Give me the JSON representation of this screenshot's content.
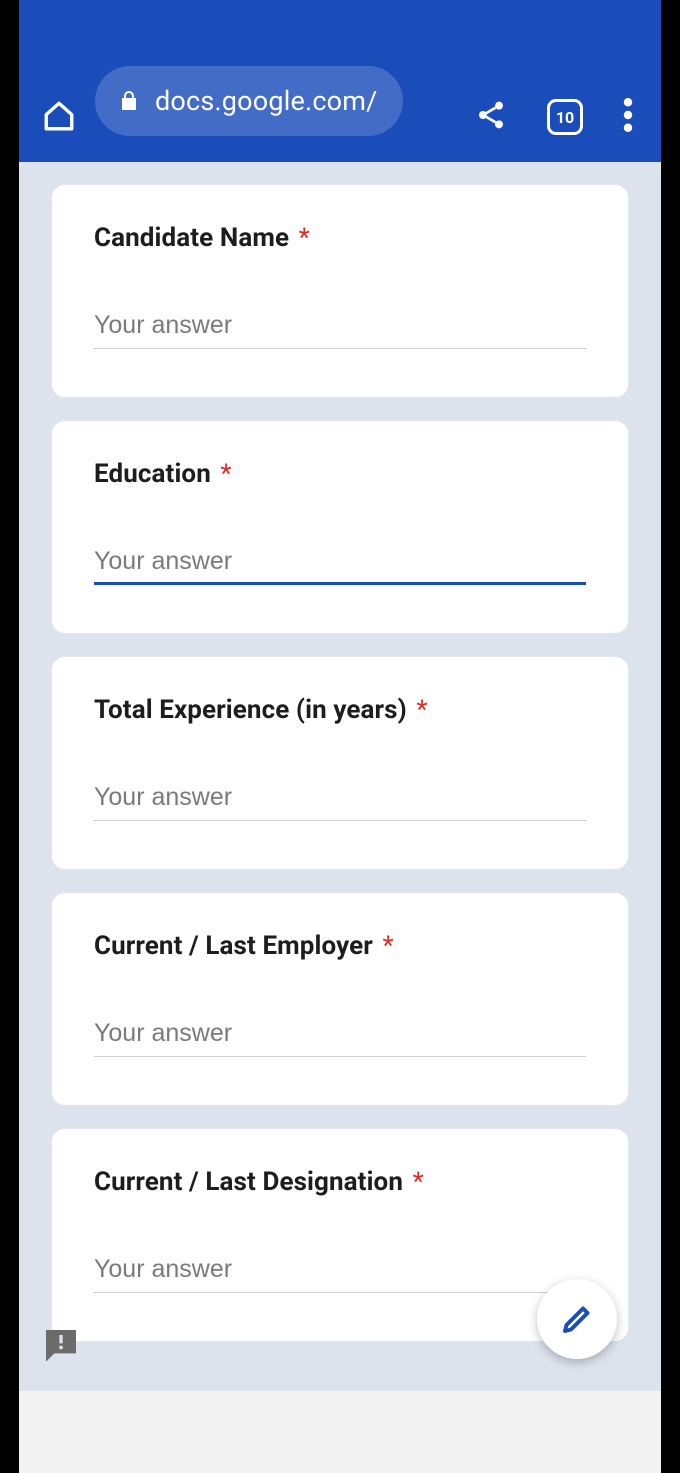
{
  "browser": {
    "url": "docs.google.com/",
    "tab_count": "10"
  },
  "form": {
    "placeholder": "Your answer",
    "focused_index": 1,
    "questions": [
      {
        "label": "Candidate Name",
        "required": true,
        "value": ""
      },
      {
        "label": "Education",
        "required": true,
        "value": ""
      },
      {
        "label": "Total Experience (in years)",
        "required": true,
        "value": ""
      },
      {
        "label": "Current / Last Employer",
        "required": true,
        "value": ""
      },
      {
        "label": "Current / Last Designation",
        "required": true,
        "value": ""
      }
    ]
  }
}
